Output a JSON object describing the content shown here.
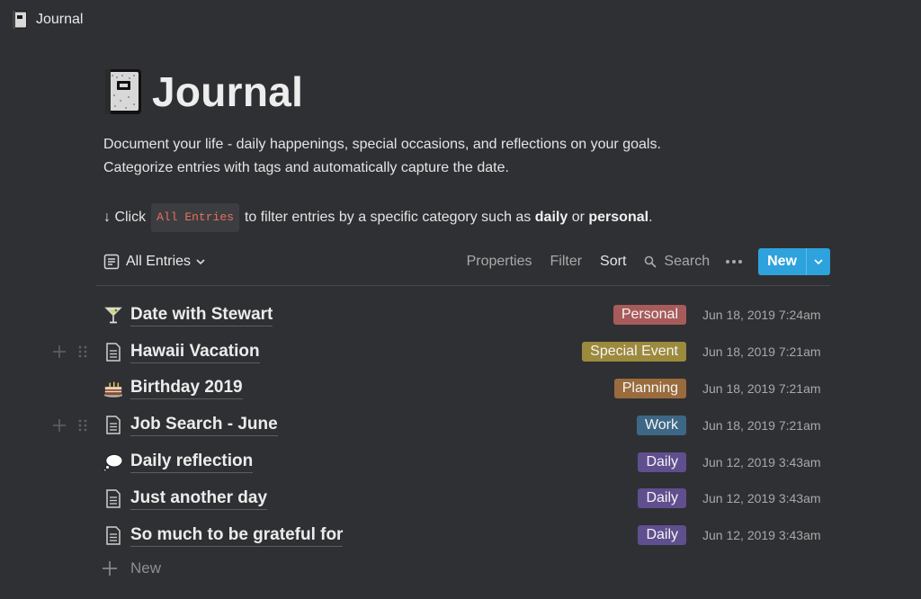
{
  "topbar": {
    "breadcrumb": "Journal",
    "icon": "journal-book-icon"
  },
  "page": {
    "title": "Journal",
    "icon": "journal-book-icon",
    "description_line1": "Document your life - daily happenings, special occasions, and reflections on your goals.",
    "description_line2": "Categorize entries with tags and automatically capture the date.",
    "hint_prefix": "↓ Click",
    "hint_code": "All Entries",
    "hint_middle": "to filter entries by a specific category such as",
    "hint_bold1": "daily",
    "hint_or": "or",
    "hint_bold2": "personal",
    "hint_end": "."
  },
  "viewbar": {
    "view_label": "All Entries",
    "properties": "Properties",
    "filter": "Filter",
    "sort": "Sort",
    "search": "Search",
    "new_label": "New",
    "accent": "#2ea2dc"
  },
  "entries": [
    {
      "icon": "cocktail-glass-icon",
      "name": "Date with Stewart",
      "tag": "Personal",
      "tag_color": "#a85b5b",
      "date": "Jun 18, 2019 7:24am"
    },
    {
      "icon": "page-icon",
      "name": "Hawaii Vacation",
      "tag": "Special Event",
      "tag_color": "#9c8a3d",
      "date": "Jun 18, 2019 7:21am"
    },
    {
      "icon": "birthday-cake-icon",
      "name": "Birthday 2019",
      "tag": "Planning",
      "tag_color": "#9a6b3c",
      "date": "Jun 18, 2019 7:21am"
    },
    {
      "icon": "page-icon",
      "name": "Job Search - June",
      "tag": "Work",
      "tag_color": "#3d6785",
      "date": "Jun 18, 2019 7:21am"
    },
    {
      "icon": "thought-bubble-icon",
      "name": "Daily reflection",
      "tag": "Daily",
      "tag_color": "#5f4f8e",
      "date": "Jun 12, 2019 3:43am"
    },
    {
      "icon": "page-icon",
      "name": "Just another day",
      "tag": "Daily",
      "tag_color": "#5f4f8e",
      "date": "Jun 12, 2019 3:43am"
    },
    {
      "icon": "page-icon",
      "name": "So much to be grateful for",
      "tag": "Daily",
      "tag_color": "#5f4f8e",
      "date": "Jun 12, 2019 3:43am"
    }
  ],
  "new_row_label": "New"
}
